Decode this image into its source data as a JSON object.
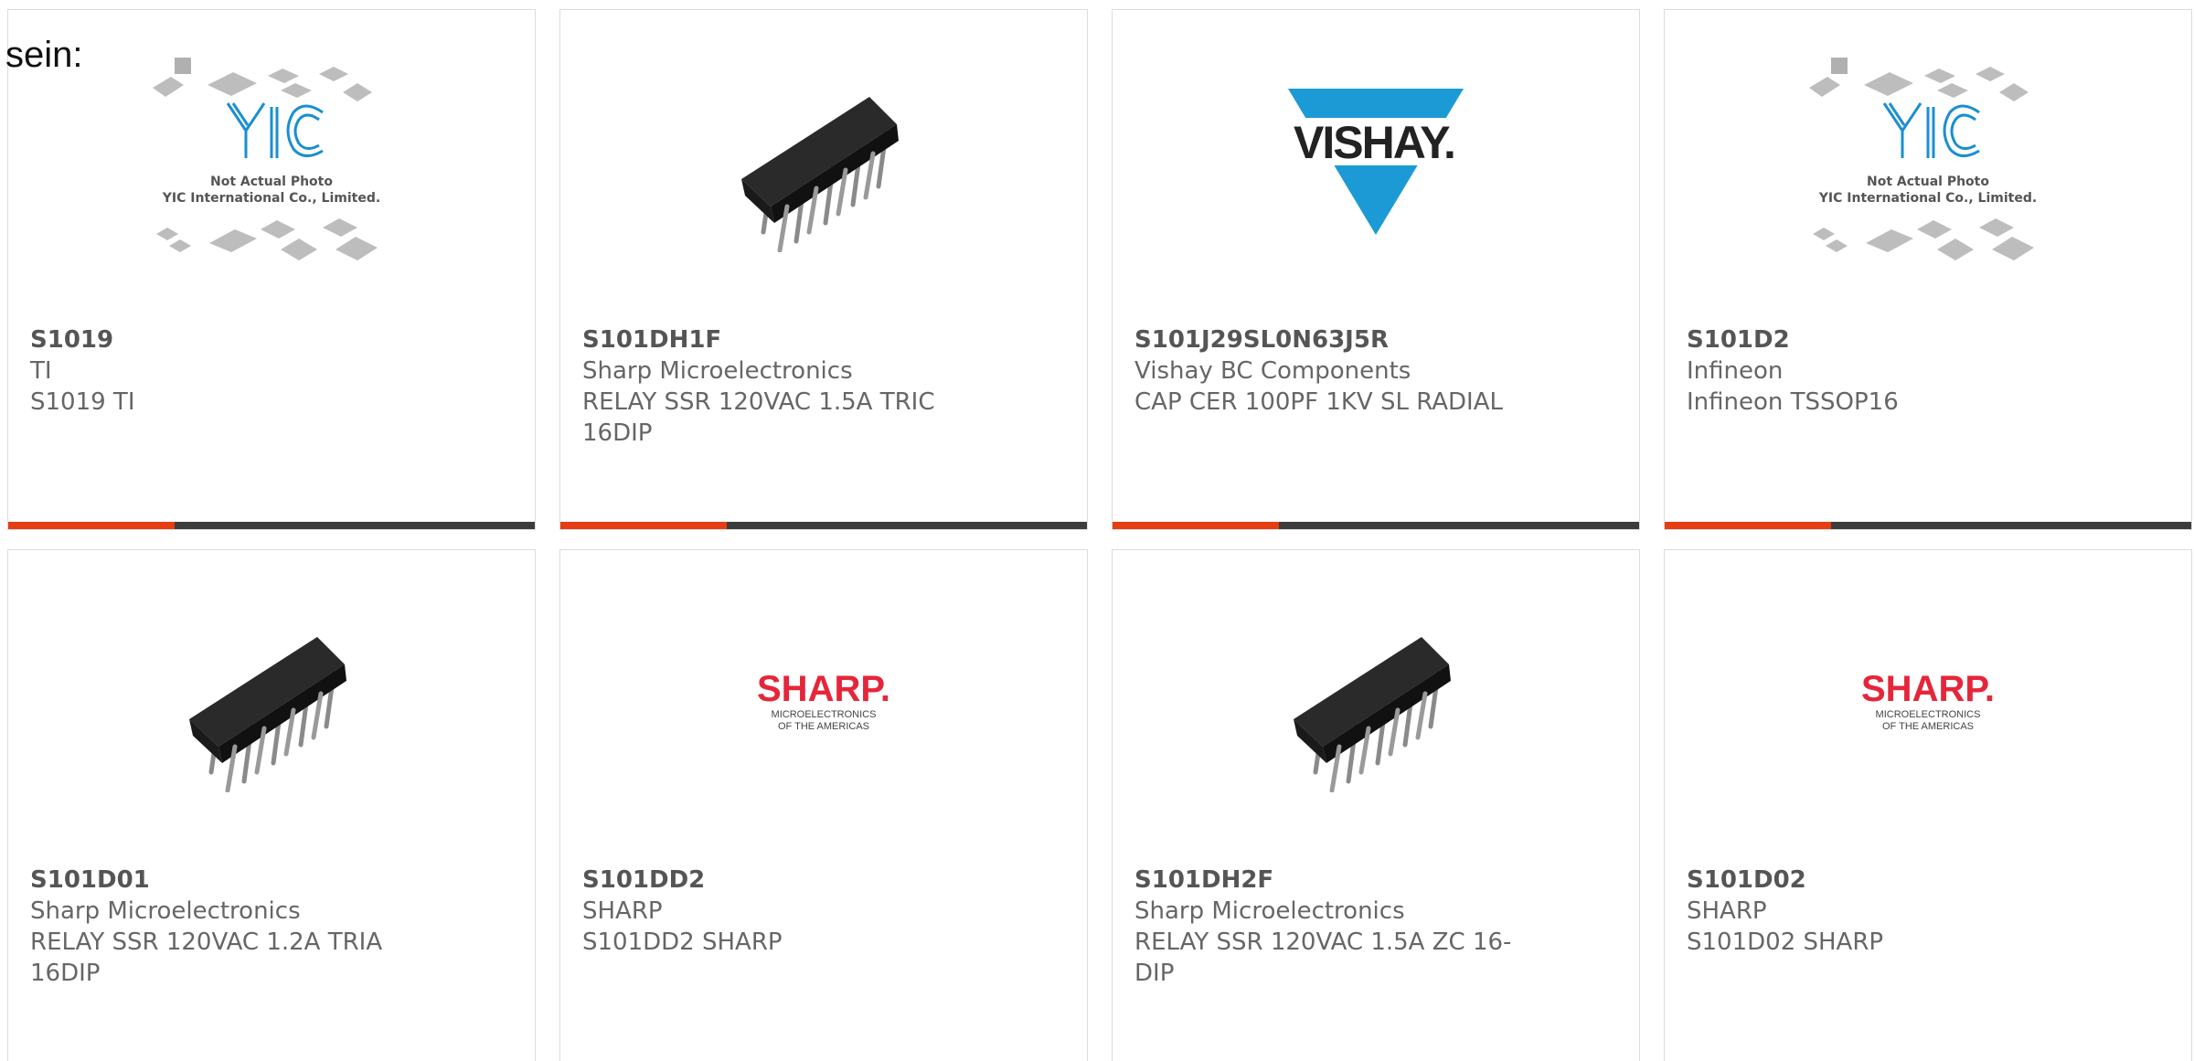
{
  "intro_text": "sein:",
  "colors": {
    "accent_bar": "#e63d12",
    "bar_dark": "#3c3c3c",
    "vishay_blue": "#1b9ad6",
    "sharp_red": "#e5263a"
  },
  "placeholder_logo": {
    "brand": "YIC",
    "line1": "Not Actual Photo",
    "line2": "YIC International Co., Limited."
  },
  "vishay_logo": {
    "text": "VISHAY."
  },
  "sharp_logo": {
    "text": "SHARP.",
    "line1": "MICROELECTRONICS",
    "line2": "OF THE AMERICAS"
  },
  "products": [
    {
      "part": "S1019",
      "manufacturer": "TI",
      "description": "S1019 TI",
      "image": "yic-placeholder"
    },
    {
      "part": "S101DH1F",
      "manufacturer": "Sharp Microelectronics",
      "description": "RELAY SSR 120VAC 1.5A TRIC 16DIP",
      "image": "dip-chip"
    },
    {
      "part": "S101J29SL0N63J5R",
      "manufacturer": "Vishay BC Components",
      "description": "CAP CER 100PF 1KV SL RADIAL",
      "image": "vishay-logo"
    },
    {
      "part": "S101D2",
      "manufacturer": "Infineon",
      "description": "Infineon TSSOP16",
      "image": "yic-placeholder"
    },
    {
      "part": "S101D01",
      "manufacturer": "Sharp Microelectronics",
      "description": "RELAY SSR 120VAC 1.2A TRIA 16DIP",
      "image": "dip-chip"
    },
    {
      "part": "S101DD2",
      "manufacturer": "SHARP",
      "description": "S101DD2 SHARP",
      "image": "sharp-logo"
    },
    {
      "part": "S101DH2F",
      "manufacturer": "Sharp Microelectronics",
      "description": "RELAY SSR 120VAC 1.5A ZC 16-DIP",
      "image": "dip-chip"
    },
    {
      "part": "S101D02",
      "manufacturer": "SHARP",
      "description": "S101D02 SHARP",
      "image": "sharp-logo"
    }
  ]
}
